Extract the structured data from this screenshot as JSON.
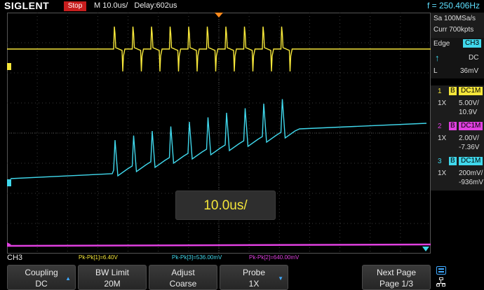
{
  "header": {
    "brand": "SIGLENT",
    "run_state": "Stop",
    "timebase": "M 10.0us/",
    "delay": "Delay:602us",
    "frequency": "f = 250.406Hz"
  },
  "acquisition": {
    "sample_rate": "Sa 100MSa/s",
    "memory": "Curr 700kpts"
  },
  "trigger": {
    "type": "Edge",
    "source": "CH3",
    "slope_icon": "rising-edge-icon",
    "coupling": "DC",
    "level_label": "L",
    "level": "36mV"
  },
  "channels": [
    {
      "num": "1",
      "bw": "B",
      "coupling": "DC1M",
      "probe": "1X",
      "scale": "5.00V/",
      "offset": "10.9V",
      "color": "#f5e63a"
    },
    {
      "num": "2",
      "bw": "B",
      "coupling": "DC1M",
      "probe": "1X",
      "scale": "2.00V/",
      "offset": "-7.36V",
      "color": "#e040e0"
    },
    {
      "num": "3",
      "bw": "B",
      "coupling": "DC1M",
      "probe": "1X",
      "scale": "200mV/",
      "offset": "-936mV",
      "color": "#40d8ec"
    }
  ],
  "overlay": {
    "timebase_popup": "10.0us/"
  },
  "active_channel": "CH3",
  "measurements": [
    {
      "label": "Pk-Pk[1]=6.40V",
      "color": "#f5e63a"
    },
    {
      "label": "Pk-Pk[3]=536.00mV",
      "color": "#40d8ec"
    },
    {
      "label": "Pk-Pk[2]=640.00mV",
      "color": "#e040e0"
    }
  ],
  "softkeys": [
    {
      "line1": "Coupling",
      "line2": "DC",
      "arrow": "▲"
    },
    {
      "line1": "BW Limit",
      "line2": "20M",
      "arrow": ""
    },
    {
      "line1": "Adjust",
      "line2": "Coarse",
      "arrow": ""
    },
    {
      "line1": "Probe",
      "line2": "1X",
      "arrow": "▼"
    },
    {
      "line1": "Next Page",
      "line2": "Page 1/3",
      "arrow": ""
    }
  ],
  "colors": {
    "ch1": "#f5e63a",
    "ch2": "#e040e0",
    "ch3": "#40d8ec",
    "grid": "#3a3a3a",
    "accent": "#3fa9ff",
    "stop": "#c81e1e"
  }
}
